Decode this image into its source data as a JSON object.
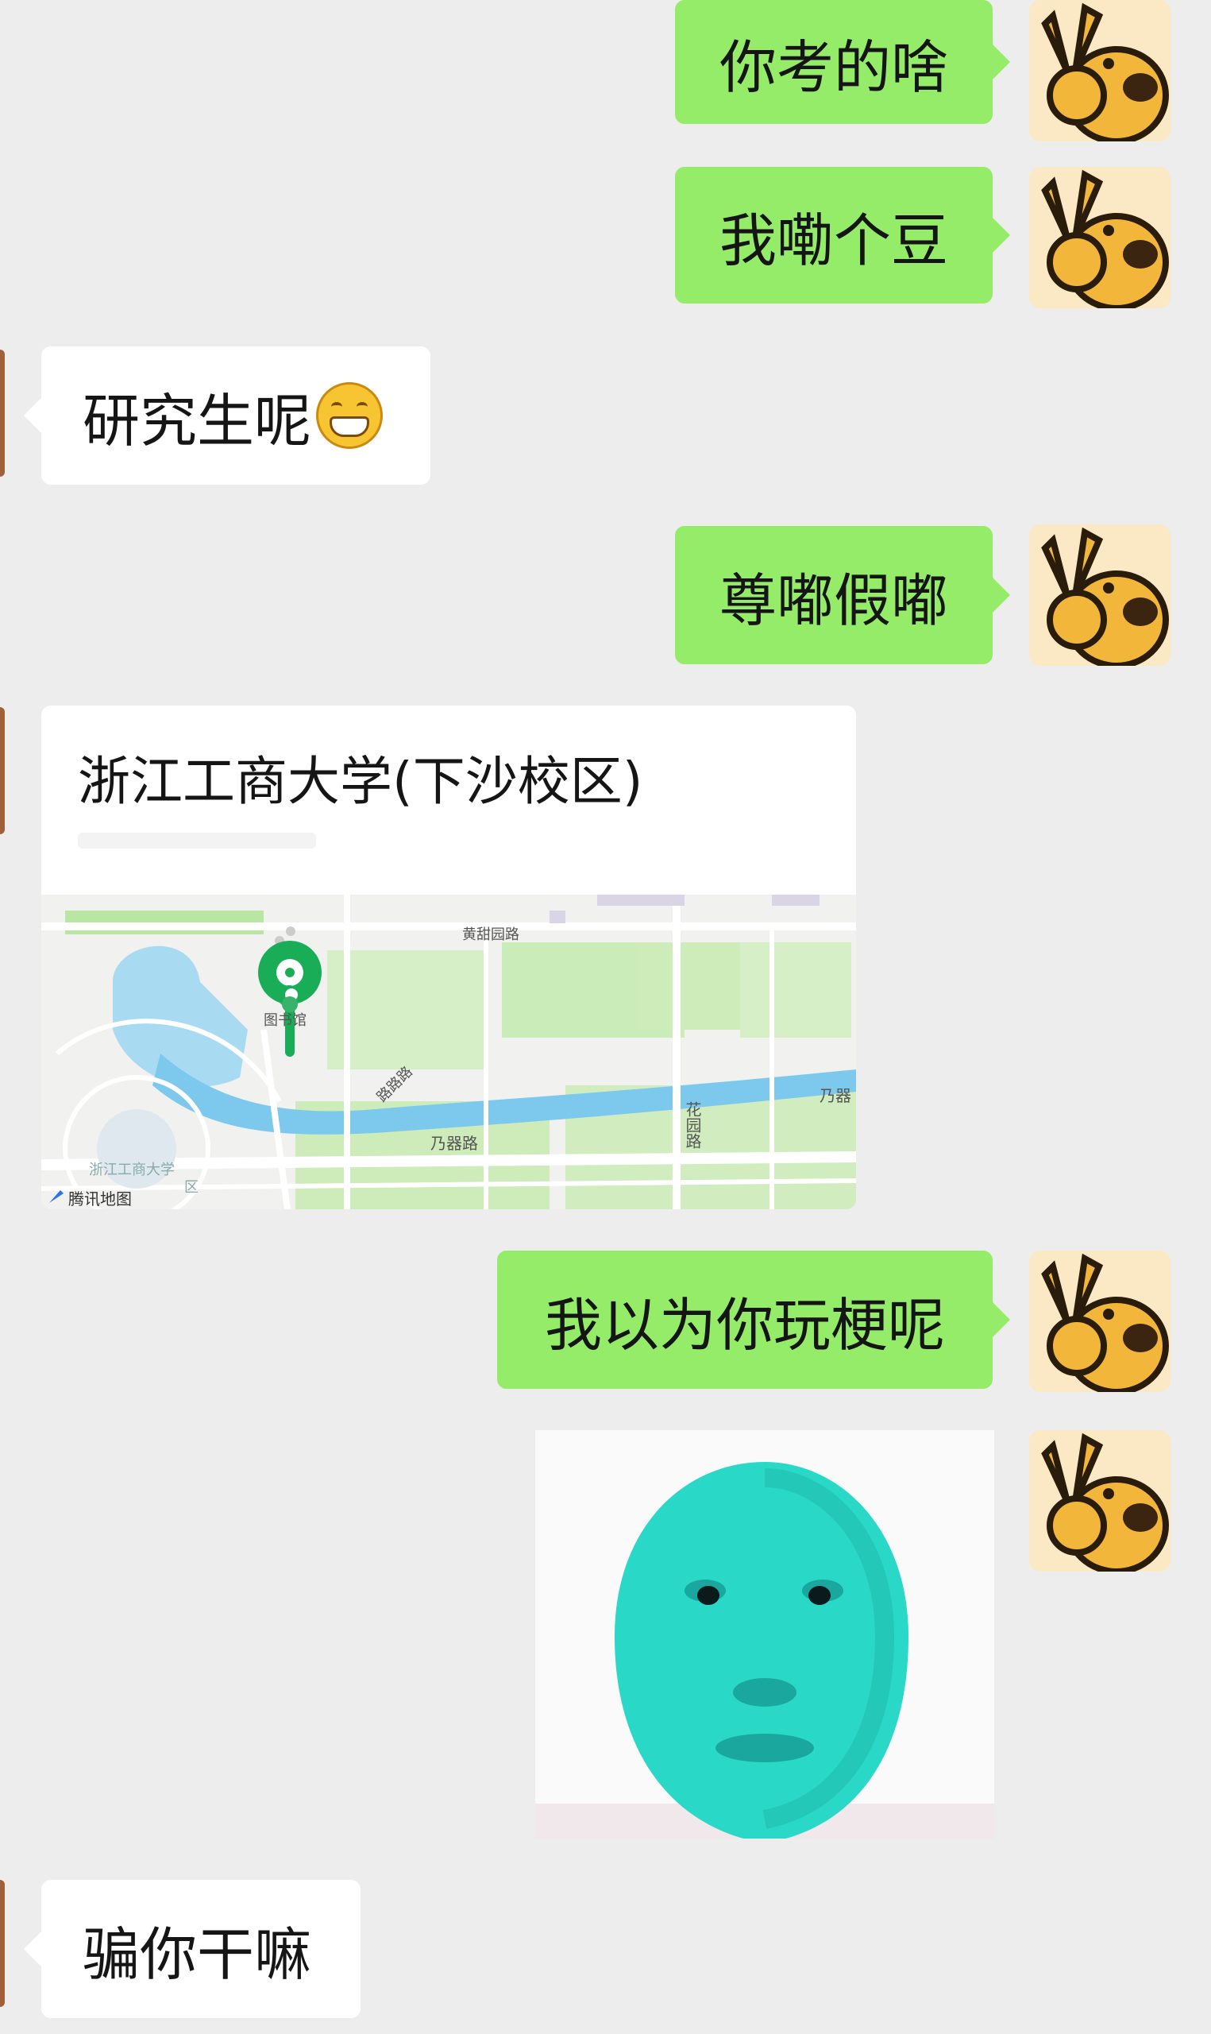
{
  "messages": [
    {
      "side": "out",
      "text": "你考的啥"
    },
    {
      "side": "out",
      "text": "我嘞个豆"
    },
    {
      "side": "in",
      "text": "研究生呢",
      "emoji": "grinning-face-emoji"
    },
    {
      "side": "out",
      "text": "尊嘟假嘟"
    },
    {
      "side": "in",
      "type": "location",
      "title": "浙江工商大学(下沙校区)"
    },
    {
      "side": "out",
      "text": "我以为你玩梗呢"
    },
    {
      "side": "out",
      "type": "sticker",
      "sticker": "green-face-sticker"
    },
    {
      "side": "in",
      "text": "骗你干嘛"
    }
  ],
  "map": {
    "labels": {
      "road_top": "黄甜园路",
      "library": "图书馆",
      "road_side": "路路路",
      "road_main": "乃器路",
      "road_right": "乃器",
      "road_vertical": "花园路",
      "campus": "浙江工商大学",
      "campus_sub": "区",
      "brand": "腾讯地图"
    }
  },
  "colors": {
    "background": "#ededed",
    "outgoing_bubble": "#95ec69",
    "incoming_bubble": "#ffffff",
    "map_pin": "#1aad57"
  }
}
